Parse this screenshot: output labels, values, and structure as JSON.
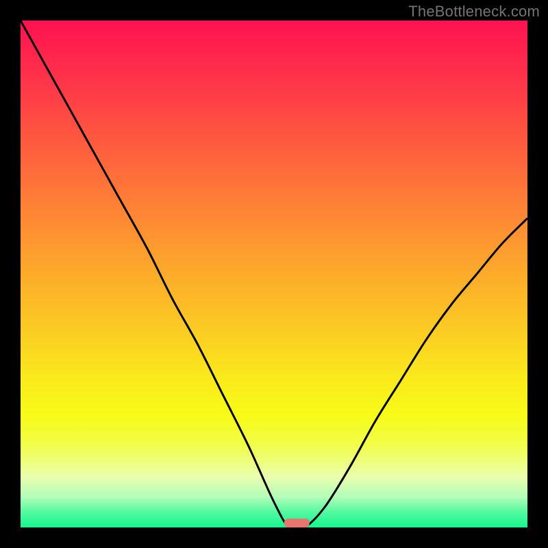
{
  "attribution": "TheBottleneck.com",
  "chart_data": {
    "type": "line",
    "title": "",
    "xlabel": "",
    "ylabel": "",
    "xlim": [
      0,
      1
    ],
    "ylim": [
      0,
      1
    ],
    "series": [
      {
        "name": "bottleneck-curve",
        "x": [
          0.0,
          0.05,
          0.1,
          0.15,
          0.2,
          0.25,
          0.3,
          0.35,
          0.4,
          0.45,
          0.5,
          0.53,
          0.56,
          0.6,
          0.65,
          0.7,
          0.75,
          0.8,
          0.85,
          0.9,
          0.95,
          1.0
        ],
        "values": [
          1.0,
          0.91,
          0.82,
          0.73,
          0.64,
          0.55,
          0.45,
          0.36,
          0.26,
          0.16,
          0.05,
          0.0,
          0.0,
          0.04,
          0.12,
          0.21,
          0.29,
          0.37,
          0.44,
          0.5,
          0.56,
          0.61
        ]
      }
    ],
    "marker": {
      "name": "optimal-point",
      "x_center": 0.545,
      "x_halfwidth": 0.025,
      "y": 0.0,
      "color": "#e8766d"
    },
    "gradient_stops": [
      {
        "offset": 0.0,
        "color": "#fe1250"
      },
      {
        "offset": 0.1,
        "color": "#fe2f4b"
      },
      {
        "offset": 0.2,
        "color": "#fe4e42"
      },
      {
        "offset": 0.3,
        "color": "#fe6c3b"
      },
      {
        "offset": 0.4,
        "color": "#fd8c33"
      },
      {
        "offset": 0.5,
        "color": "#fcab2b"
      },
      {
        "offset": 0.6,
        "color": "#fbc824"
      },
      {
        "offset": 0.7,
        "color": "#fae81c"
      },
      {
        "offset": 0.78,
        "color": "#f7fc17"
      },
      {
        "offset": 0.84,
        "color": "#f1fd4d"
      },
      {
        "offset": 0.9,
        "color": "#eafeae"
      },
      {
        "offset": 0.94,
        "color": "#b3fdb8"
      },
      {
        "offset": 0.97,
        "color": "#52f9a1"
      },
      {
        "offset": 1.0,
        "color": "#14f68d"
      }
    ]
  }
}
